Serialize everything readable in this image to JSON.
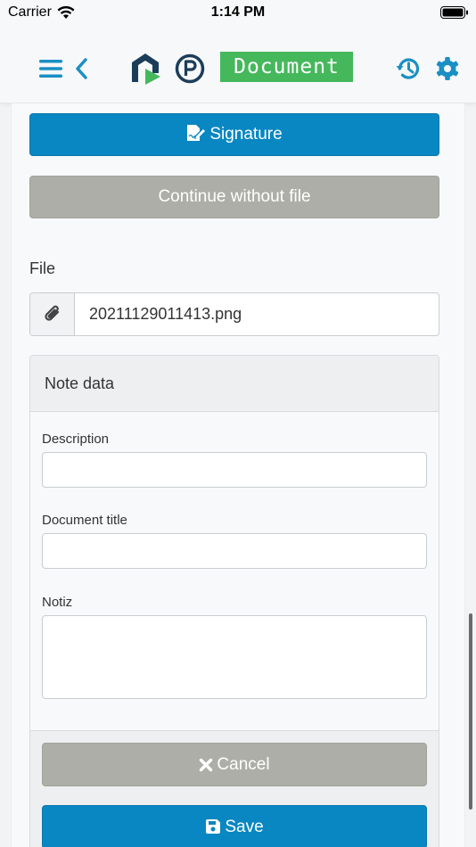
{
  "status_bar": {
    "carrier": "Carrier",
    "time": "1:14 PM",
    "wifi_icon": "wifi-icon",
    "battery_icon": "battery-icon"
  },
  "nav_bar": {
    "menu_icon": "menu-icon",
    "back_icon": "chevron-left-icon",
    "logo_icon": "app-logo-icon",
    "p_icon": "parking-p-icon",
    "title_badge": "Document",
    "history_icon": "history-icon",
    "settings_icon": "gear-icon",
    "accent_color": "#1a8fc4",
    "badge_color": "#45b85c"
  },
  "actions": {
    "signature_label": "Signature",
    "signature_icon": "signature-icon",
    "continue_label": "Continue without file"
  },
  "file": {
    "label": "File",
    "attachment_icon": "paperclip-icon",
    "filename": "20211129011413.png"
  },
  "note": {
    "header": "Note data",
    "fields": [
      {
        "label": "Description",
        "value": ""
      },
      {
        "label": "Document title",
        "value": ""
      },
      {
        "label": "Notiz",
        "value": ""
      }
    ],
    "cancel_label": "Cancel",
    "cancel_icon": "close-icon",
    "save_label": "Save",
    "save_icon": "floppy-disk-icon"
  },
  "colors": {
    "primary": "#0987c2",
    "secondary": "#aeaea8"
  }
}
